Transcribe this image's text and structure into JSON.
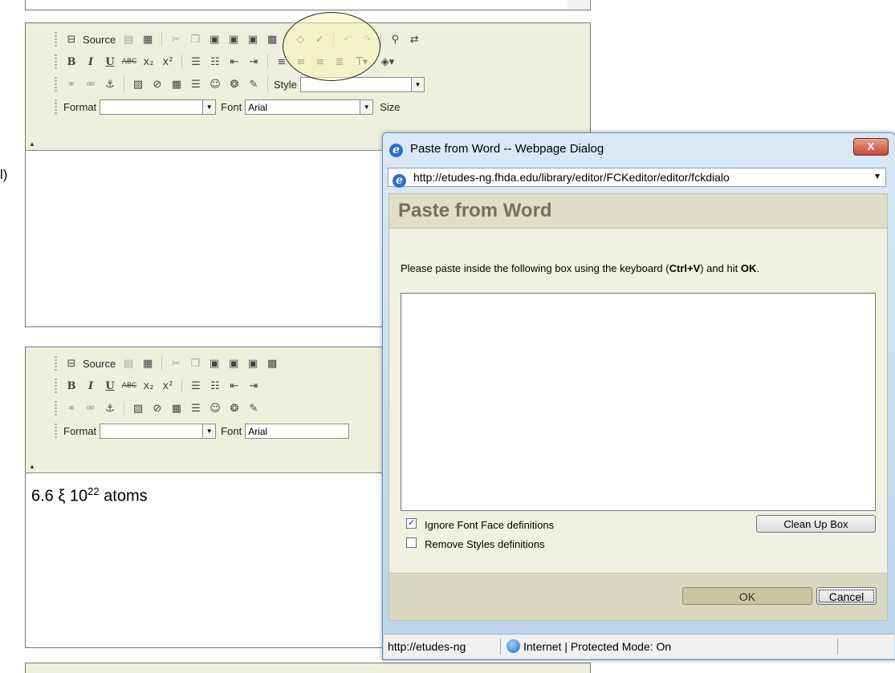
{
  "left_fragment": "l)",
  "toolbar": {
    "source_label": "Source",
    "style_label": "Style",
    "format_label": "Format",
    "font_label": "Font",
    "font_value": "Arial",
    "size_label": "Size"
  },
  "editor2": {
    "content_prefix": "6.6 ξ 10",
    "content_sup": "22",
    "content_suffix": " atoms"
  },
  "dialog": {
    "title": "Paste from Word -- Webpage Dialog",
    "close_glyph": "X",
    "address": "http://etudes-ng.fhda.edu/library/editor/FCKeditor/editor/fckdialo",
    "heading": "Paste from Word",
    "instruction_prefix": "Please paste inside the following box using the keyboard (",
    "instruction_key": "Ctrl+V",
    "instruction_middle": ") and hit ",
    "instruction_ok": "OK",
    "instruction_suffix": ".",
    "ignore_font_label": "Ignore Font Face definitions",
    "ignore_font_checked": true,
    "remove_styles_label": "Remove Styles definitions",
    "remove_styles_checked": false,
    "cleanup_label": "Clean Up Box",
    "ok_label": "OK",
    "cancel_label": "Cancel",
    "status_url": "http://etudes-ng",
    "status_zone": "Internet | Protected Mode: On"
  },
  "colors": {
    "highlight": "#f7f4b8",
    "dialog_heading": "#737357"
  },
  "icons": [
    "source-icon",
    "cut-icon",
    "copy-icon",
    "paste-icon",
    "paste-text-icon",
    "paste-word-icon",
    "print-icon",
    "eraser-icon",
    "spellcheck-icon",
    "undo-icon",
    "redo-icon",
    "find-icon",
    "replace-icon",
    "link-icon",
    "unlink-icon",
    "anchor-icon",
    "image-icon",
    "flash-icon",
    "table-icon",
    "rule-icon",
    "smiley-icon",
    "special-char-icon",
    "page-break-icon"
  ]
}
